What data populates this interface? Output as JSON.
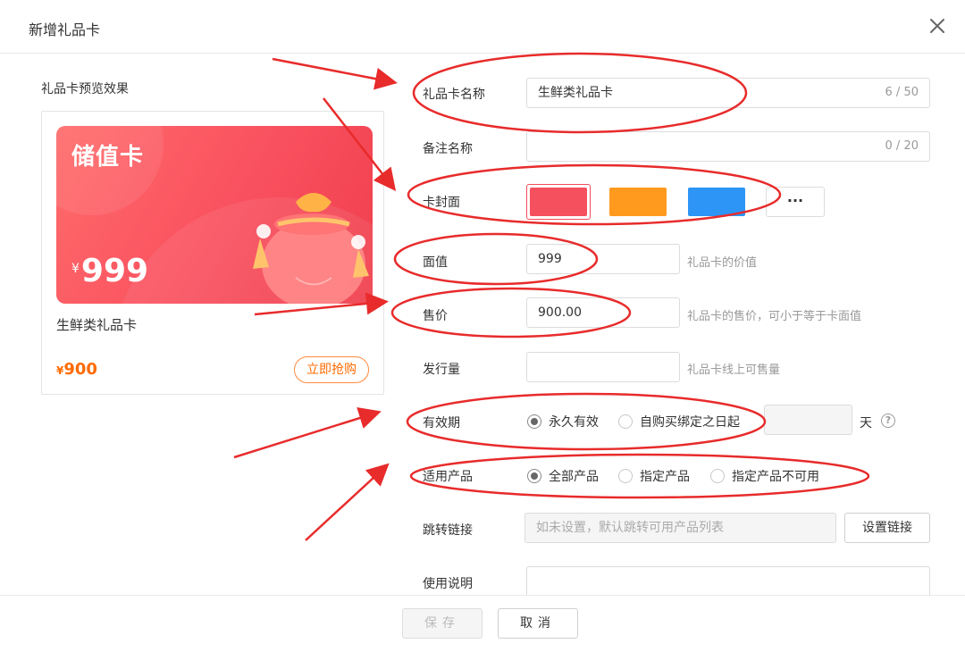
{
  "dialog": {
    "title": "新增礼品卡",
    "close_icon": "close-icon"
  },
  "preview": {
    "label": "礼品卡预览效果",
    "card_title": "储值卡",
    "card_currency": "¥",
    "card_value": "999",
    "card_name": "生鲜类礼品卡",
    "price_currency": "¥",
    "price": "900",
    "buy_label": "立即抢购",
    "card_color": "#f9505f",
    "price_color": "#ff6a00"
  },
  "form": {
    "name": {
      "label": "礼品卡名称",
      "value": "生鲜类礼品卡",
      "counter": "6 / 50"
    },
    "remark": {
      "label": "备注名称",
      "value": "",
      "counter": "0 / 20"
    },
    "cover": {
      "label": "卡封面",
      "swatches": [
        "#f5505e",
        "#ff9a1f",
        "#2d95f5"
      ],
      "selected": 0,
      "more_label": "···"
    },
    "face_value": {
      "label": "面值",
      "value": "999",
      "hint": "礼品卡的价值"
    },
    "sale_price": {
      "label": "售价",
      "value": "900.00",
      "hint": "礼品卡的售价，可小于等于卡面值"
    },
    "issue_amount": {
      "label": "发行量",
      "value": "",
      "hint": "礼品卡线上可售量"
    },
    "validity": {
      "label": "有效期",
      "options": [
        "永久有效",
        "自购买绑定之日起"
      ],
      "selected": 0,
      "days_value": "",
      "unit": "天",
      "help_icon": "question-icon"
    },
    "applicable": {
      "label": "适用产品",
      "options": [
        "全部产品",
        "指定产品",
        "指定产品不可用"
      ],
      "selected": 0
    },
    "link": {
      "label": "跳转链接",
      "placeholder": "如未设置，默认跳转可用产品列表",
      "button": "设置链接"
    },
    "usage": {
      "label": "使用说明",
      "value": ""
    }
  },
  "footer": {
    "save_label": "保存",
    "cancel_label": "取消"
  },
  "annotations": {
    "color": "#e82b2b"
  }
}
